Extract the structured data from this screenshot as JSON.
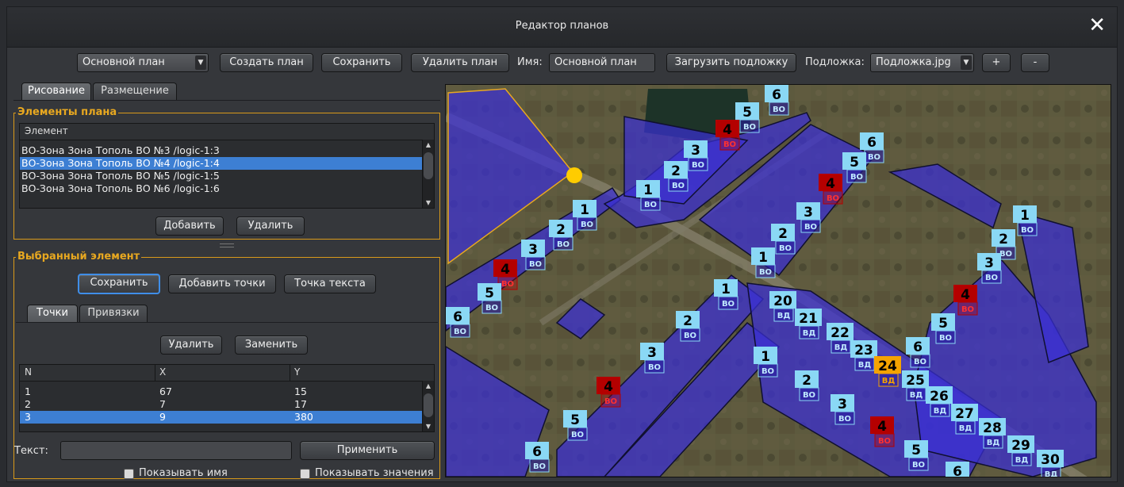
{
  "window": {
    "title": "Редактор планов",
    "close_icon": "close-icon"
  },
  "toolbar": {
    "plan_select": "Основной план",
    "create_plan": "Создать план",
    "save": "Сохранить",
    "delete_plan": "Удалить план",
    "name_label": "Имя:",
    "name_value": "Основной план",
    "load_underlay": "Загрузить подложку",
    "underlay_label": "Подложка:",
    "underlay_select": "Подложка.jpg",
    "zoom_in": "+",
    "zoom_out": "-"
  },
  "left_tabs": [
    {
      "label": "Рисование",
      "active": true
    },
    {
      "label": "Размещение",
      "active": false
    }
  ],
  "elements_group": {
    "title": "Элементы плана",
    "column": "Элемент",
    "rows": [
      "ВО-Зона Зона Тополь ВО №3 /logic-1:3",
      "ВО-Зона Зона Тополь ВО №4 /logic-1:4",
      "ВО-Зона Зона Тополь ВО №5 /logic-1:5",
      "ВО-Зона Зона Тополь ВО №6 /logic-1:6"
    ],
    "selected_index": 1,
    "add": "Добавить",
    "delete": "Удалить"
  },
  "selected_group": {
    "title": "Выбранный элемент",
    "save": "Сохранить",
    "add_points": "Добавить точки",
    "text_point": "Точка текста",
    "tabs": [
      {
        "label": "Точки",
        "active": true
      },
      {
        "label": "Привязки",
        "active": false
      }
    ],
    "delete": "Удалить",
    "replace": "Заменить",
    "columns": [
      "N",
      "X",
      "Y"
    ],
    "points": [
      {
        "n": "1",
        "x": "67",
        "y": "15"
      },
      {
        "n": "2",
        "x": "7",
        "y": "17"
      },
      {
        "n": "3",
        "x": "9",
        "y": "380"
      }
    ],
    "selected_point": 2,
    "text_label": "Текст:",
    "text_value": "",
    "apply": "Применить",
    "show_name": "Показывать имя",
    "show_values": "Показывать значения"
  },
  "colors": {
    "accent": "#e8a820",
    "selection": "#3d7fd3",
    "zone_fill": "#3a2fd6",
    "marker_blue": "#8ad8f5",
    "marker_red": "#b40000",
    "marker_orange": "#f5a300",
    "handle": "#ffcc00"
  },
  "map": {
    "markers": [
      {
        "num": "6",
        "tag": "ВО",
        "state": "normal"
      },
      {
        "num": "5",
        "tag": "ВО",
        "state": "normal"
      },
      {
        "num": "4",
        "tag": "ВО",
        "state": "alarm"
      },
      {
        "num": "3",
        "tag": "ВО",
        "state": "normal"
      },
      {
        "num": "2",
        "tag": "ВО",
        "state": "normal"
      },
      {
        "num": "1",
        "tag": "ВО",
        "state": "normal"
      },
      {
        "num": "1",
        "tag": "ВО",
        "state": "normal"
      },
      {
        "num": "2",
        "tag": "ВО",
        "state": "normal"
      },
      {
        "num": "3",
        "tag": "ВО",
        "state": "normal"
      },
      {
        "num": "4",
        "tag": "ВО",
        "state": "alarm"
      },
      {
        "num": "5",
        "tag": "ВО",
        "state": "normal"
      },
      {
        "num": "6",
        "tag": "ВО",
        "state": "normal"
      },
      {
        "num": "6",
        "tag": "ВО",
        "state": "normal"
      },
      {
        "num": "5",
        "tag": "ВО",
        "state": "normal"
      },
      {
        "num": "4",
        "tag": "ВО",
        "state": "alarm"
      },
      {
        "num": "3",
        "tag": "ВО",
        "state": "normal"
      },
      {
        "num": "2",
        "tag": "ВО",
        "state": "normal"
      },
      {
        "num": "1",
        "tag": "ВО",
        "state": "normal"
      },
      {
        "num": "1",
        "tag": "ВО",
        "state": "normal"
      },
      {
        "num": "2",
        "tag": "ВО",
        "state": "normal"
      },
      {
        "num": "3",
        "tag": "ВО",
        "state": "normal"
      },
      {
        "num": "4",
        "tag": "ВО",
        "state": "alarm"
      },
      {
        "num": "5",
        "tag": "ВО",
        "state": "normal"
      },
      {
        "num": "6",
        "tag": "ВО",
        "state": "normal"
      },
      {
        "num": "1",
        "tag": "ВО",
        "state": "normal"
      },
      {
        "num": "2",
        "tag": "ВО",
        "state": "normal"
      },
      {
        "num": "3",
        "tag": "ВО",
        "state": "normal"
      },
      {
        "num": "4",
        "tag": "ВО",
        "state": "alarm"
      },
      {
        "num": "5",
        "tag": "ВО",
        "state": "normal"
      },
      {
        "num": "6",
        "tag": "ВО",
        "state": "normal"
      },
      {
        "num": "20",
        "tag": "ВД",
        "state": "normal"
      },
      {
        "num": "21",
        "tag": "ВД",
        "state": "normal"
      },
      {
        "num": "22",
        "tag": "ВД",
        "state": "normal"
      },
      {
        "num": "23",
        "tag": "ВД",
        "state": "normal"
      },
      {
        "num": "24",
        "tag": "ВД",
        "state": "warning"
      },
      {
        "num": "25",
        "tag": "ВД",
        "state": "normal"
      },
      {
        "num": "26",
        "tag": "ВД",
        "state": "normal"
      },
      {
        "num": "27",
        "tag": "ВД",
        "state": "normal"
      },
      {
        "num": "28",
        "tag": "ВД",
        "state": "normal"
      },
      {
        "num": "29",
        "tag": "ВД",
        "state": "normal"
      },
      {
        "num": "30",
        "tag": "ВД",
        "state": "normal"
      },
      {
        "num": "1",
        "tag": "ВО",
        "state": "normal"
      },
      {
        "num": "2",
        "tag": "ВО",
        "state": "normal"
      },
      {
        "num": "3",
        "tag": "ВО",
        "state": "normal"
      },
      {
        "num": "4",
        "tag": "ВО",
        "state": "alarm"
      },
      {
        "num": "5",
        "tag": "ВО",
        "state": "normal"
      },
      {
        "num": "6",
        "tag": "ВО",
        "state": "normal"
      }
    ]
  }
}
